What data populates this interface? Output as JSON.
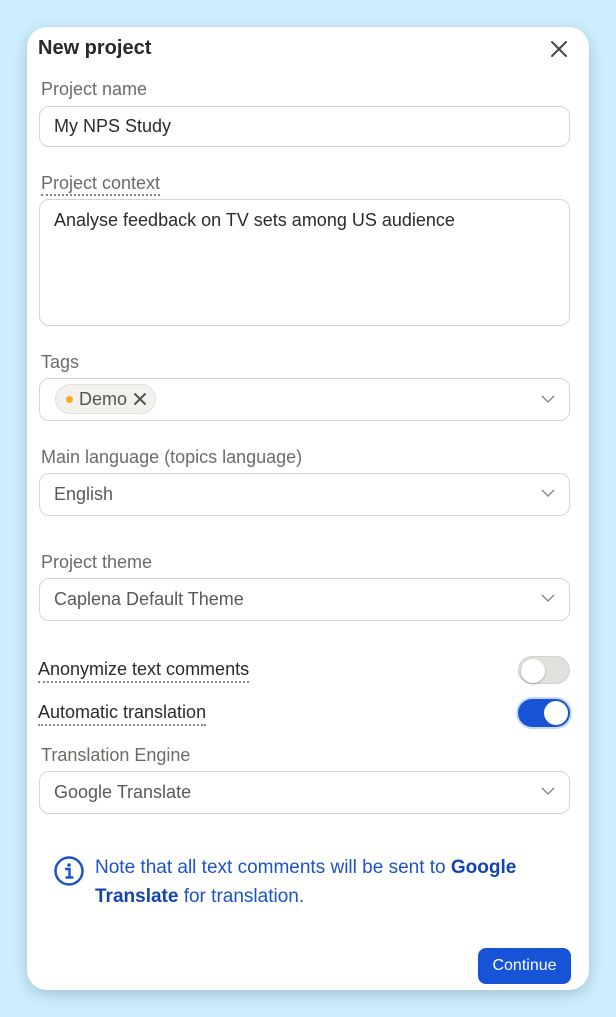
{
  "dialog": {
    "title": "New project",
    "project_name": {
      "label": "Project name",
      "value": "My NPS Study"
    },
    "project_context": {
      "label": "Project context",
      "value": "Analyse feedback on TV sets among US audience"
    },
    "tags": {
      "label": "Tags",
      "items": [
        {
          "label": "Demo",
          "color": "#f2b01e"
        }
      ]
    },
    "main_language": {
      "label": "Main language (topics language)",
      "value": "English"
    },
    "project_theme": {
      "label": "Project theme",
      "value": "Caplena Default Theme"
    },
    "anonymize": {
      "label": "Anonymize text comments",
      "enabled": false
    },
    "auto_translation": {
      "label": "Automatic translation",
      "enabled": true
    },
    "translation_engine": {
      "label": "Translation Engine",
      "value": "Google Translate"
    },
    "note": {
      "prefix": "Note that all text comments will be sent to ",
      "link": "Google Translate",
      "suffix": " for translation."
    },
    "continue_label": "Continue"
  },
  "colors": {
    "accent": "#1753d6",
    "background": "#cdeefb",
    "tag_dot": "#f2b01e"
  },
  "icons": {
    "close": "close-icon",
    "chevron": "chevron-down-icon",
    "info": "info-icon",
    "tag_remove": "tag-remove-icon"
  }
}
